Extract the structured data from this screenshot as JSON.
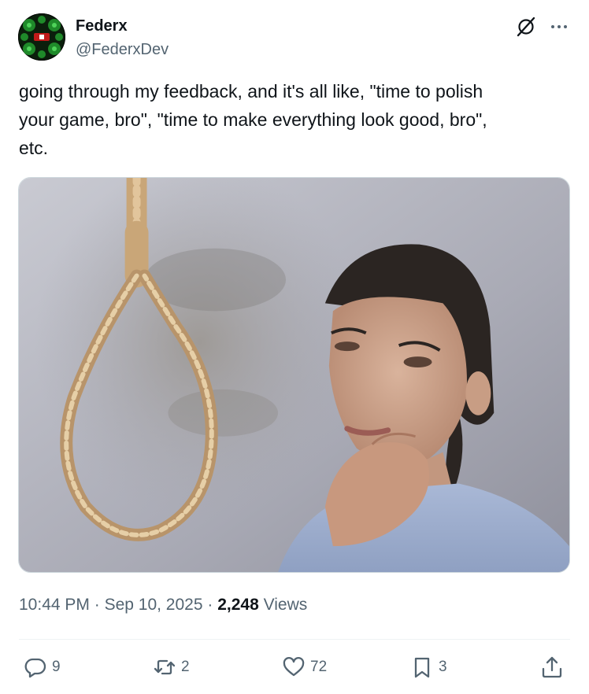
{
  "author": {
    "name": "Federx",
    "handle": "@FederxDev"
  },
  "tweet": {
    "text": "going through my feedback, and it's all like, \"time to polish\nyour game, bro\", \"time to make everything look good, bro\",\netc."
  },
  "meta": {
    "time": "10:44 PM",
    "separator": "·",
    "date": "Sep 10, 2025",
    "views_count": "2,248",
    "views_label": "Views"
  },
  "actions": {
    "replies": "9",
    "reposts": "2",
    "likes": "72",
    "bookmarks": "3"
  },
  "icons": {
    "grok": "grok-icon",
    "more": "more-icon",
    "reply": "reply-icon",
    "repost": "repost-icon",
    "like": "heart-icon",
    "bookmark": "bookmark-icon",
    "share": "share-icon"
  },
  "colors": {
    "text_primary": "#0f1419",
    "text_secondary": "#536471",
    "divider": "#eff3f4"
  }
}
